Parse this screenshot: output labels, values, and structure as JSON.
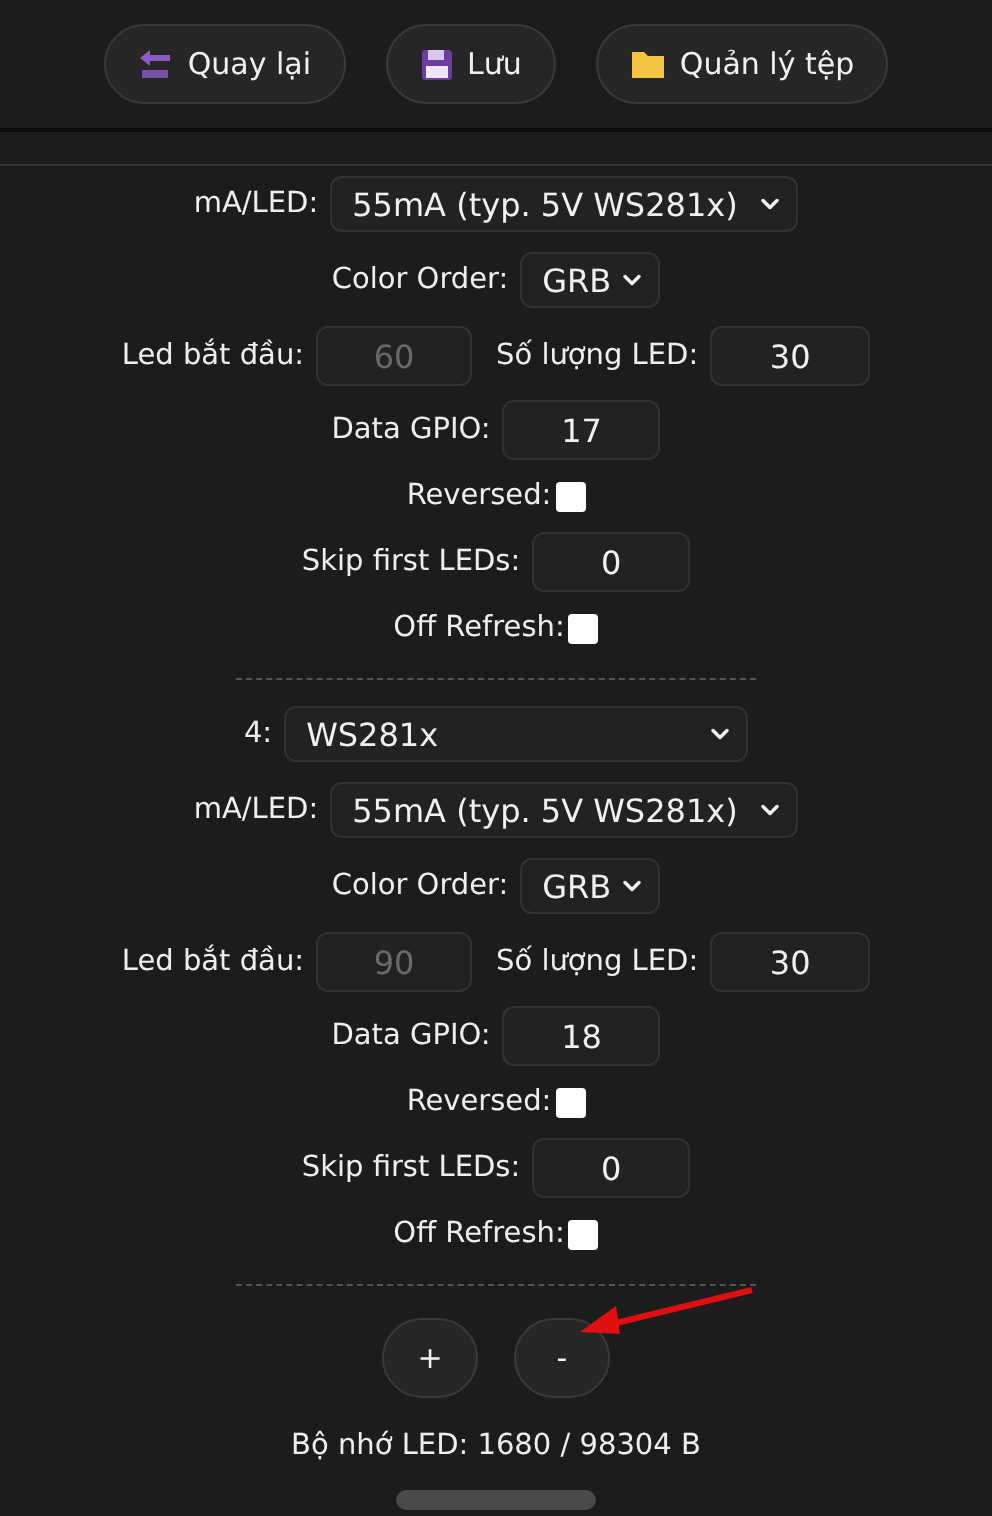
{
  "toolbar": [
    {
      "kind": "back",
      "label": "Quay lại"
    },
    {
      "kind": "save",
      "label": "Lưu"
    },
    {
      "kind": "folder",
      "label": "Quản lý tệp"
    }
  ],
  "buses": [
    {
      "ma_label": "mA/LED:",
      "ma_value": "55mA (typ. 5V WS281x)",
      "color_label": "Color Order:",
      "color_value": "GRB",
      "start_label": "Led bắt đầu:",
      "start_value": "60",
      "start_disabled": true,
      "count_label": "Số lượng LED:",
      "count_value": "30",
      "gpio_label": "Data GPIO:",
      "gpio_value": "17",
      "reversed_label": "Reversed:",
      "reversed": false,
      "skip_label": "Skip first LEDs:",
      "skip_value": "0",
      "refresh_label": "Off Refresh:",
      "off_refresh": false
    },
    {
      "index": "4:",
      "type": "WS281x",
      "ma_label": "mA/LED:",
      "ma_value": "55mA (typ. 5V WS281x)",
      "color_label": "Color Order:",
      "color_value": "GRB",
      "start_label": "Led bắt đầu:",
      "start_value": "90",
      "start_disabled": true,
      "count_label": "Số lượng LED:",
      "count_value": "30",
      "gpio_label": "Data GPIO:",
      "gpio_value": "18",
      "reversed_label": "Reversed:",
      "reversed": false,
      "skip_label": "Skip first LEDs:",
      "skip_value": "0",
      "refresh_label": "Off Refresh:",
      "off_refresh": false
    }
  ],
  "bus_buttons": [
    "+",
    "-"
  ],
  "memory": "Bộ nhớ LED: 1680 / 98304 B"
}
